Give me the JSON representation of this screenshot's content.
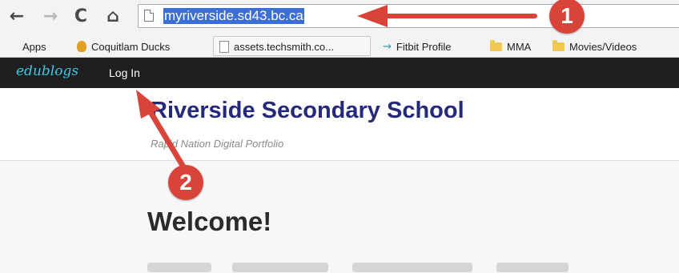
{
  "browser": {
    "back_icon": "←",
    "forward_icon": "→",
    "reload_icon": "C",
    "home_icon": "⌂",
    "url": "myriverside.sd43.bc.ca"
  },
  "bookmarks": [
    {
      "label": "Apps",
      "icon": "apps-grid-icon"
    },
    {
      "label": "Coquitlam Ducks",
      "icon": "duck-icon"
    },
    {
      "label": "assets.techsmith.co...",
      "icon": "document-icon"
    },
    {
      "label": "Fitbit Profile",
      "icon": "fitbit-icon"
    },
    {
      "label": "MMA",
      "icon": "folder-icon"
    },
    {
      "label": "Movies/Videos",
      "icon": "folder-icon"
    }
  ],
  "adminbar": {
    "logo": "edublogs",
    "login_label": "Log In"
  },
  "site": {
    "title": "Riverside Secondary School",
    "tagline": "Rapid Nation Digital Portfolio",
    "heading": "Welcome!"
  },
  "annotations": {
    "badge_1": "1",
    "badge_2": "2",
    "color": "#d8443a"
  },
  "colors": {
    "url_highlight": "#3b6fd6",
    "title": "#24297a",
    "adminbar": "#1f1f1f",
    "logo": "#3fc7e8"
  }
}
